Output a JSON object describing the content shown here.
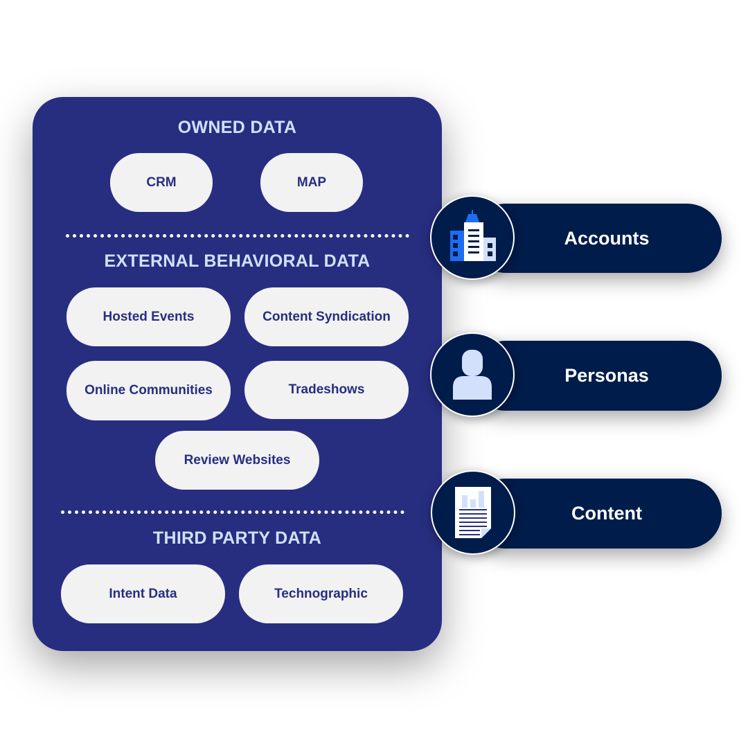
{
  "colors": {
    "panel": "#272e80",
    "pill_bg": "#f2f2f2",
    "pill_text": "#272e80",
    "heading_text": "#d3e0fb",
    "output_bar": "#001c4a",
    "icon_blue": "#1e6cf2",
    "icon_light": "#d3e0fb"
  },
  "sources": {
    "owned": {
      "heading": "OWNED DATA",
      "items": [
        "CRM",
        "MAP"
      ]
    },
    "external": {
      "heading": "EXTERNAL BEHAVIORAL DATA",
      "items": [
        "Hosted Events",
        "Content Syndication",
        "Online Communities",
        "Tradeshows",
        "Review Websites"
      ]
    },
    "third_party": {
      "heading": "THIRD PARTY DATA",
      "items": [
        "Intent Data",
        "Technographic"
      ]
    }
  },
  "outputs": [
    {
      "label": "Accounts",
      "icon": "building-icon"
    },
    {
      "label": "Personas",
      "icon": "person-icon"
    },
    {
      "label": "Content",
      "icon": "document-chart-icon"
    }
  ]
}
